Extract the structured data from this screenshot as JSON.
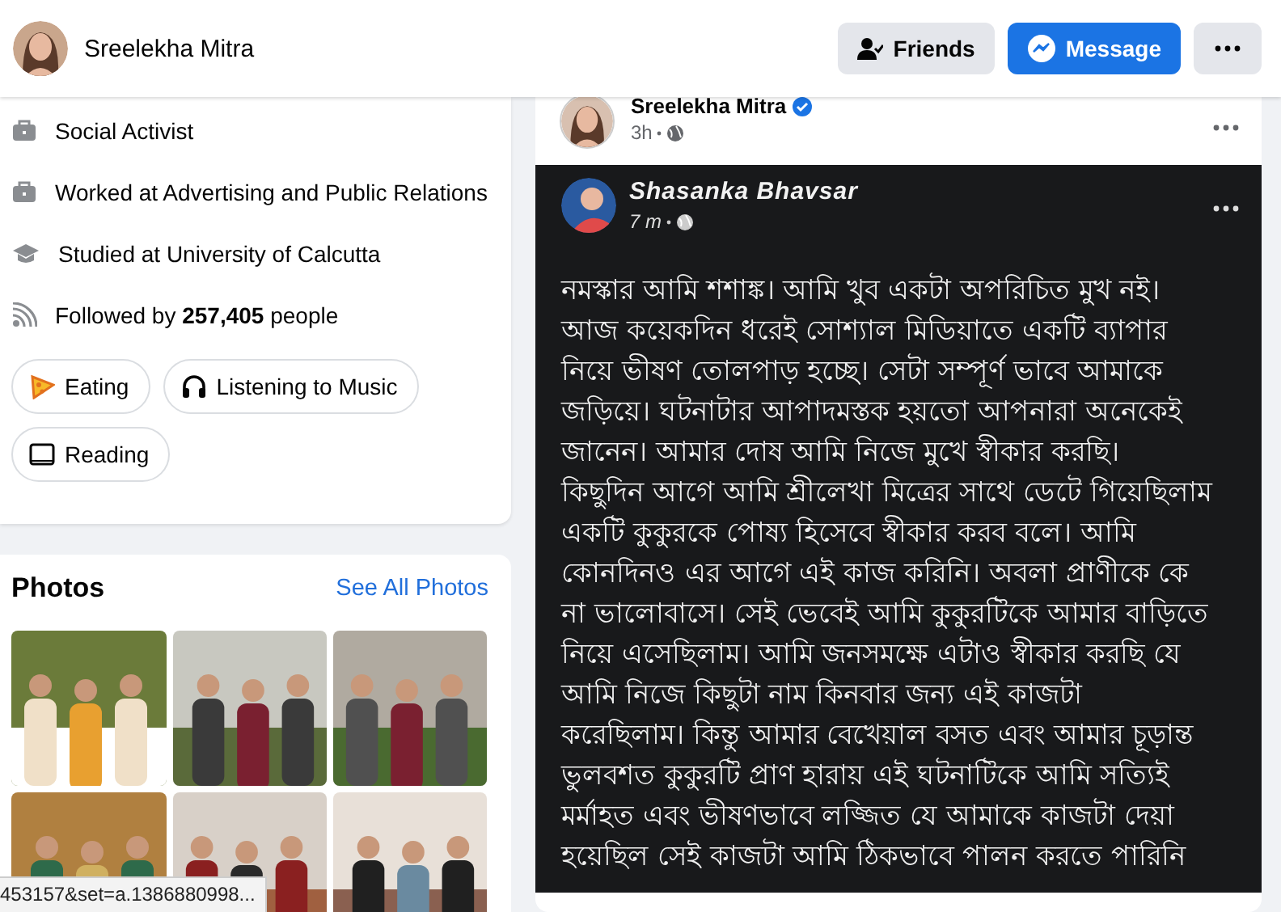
{
  "header": {
    "name": "Sreelekha Mitra",
    "buttons": [
      {
        "kind": "friends",
        "label": "Friends"
      },
      {
        "kind": "message",
        "label": "Message"
      },
      {
        "kind": "more"
      }
    ]
  },
  "intro": {
    "items": [
      {
        "kind": "work",
        "text": "Social Activist"
      },
      {
        "kind": "work",
        "text": "Worked at Advertising and Public Relations"
      },
      {
        "kind": "education",
        "text": "Studied at University of Calcutta"
      },
      {
        "kind": "followers",
        "text": "Followed by **257,405** people"
      }
    ],
    "hobbies": [
      {
        "kind": "food",
        "label": "Eating"
      },
      {
        "kind": "music",
        "label": "Listening to Music"
      },
      {
        "kind": "book",
        "label": "Reading"
      }
    ]
  },
  "photos": {
    "title": "Photos",
    "link": "See All Photos"
  },
  "post": {
    "author": "Sreelekha Mitra",
    "verified": true,
    "time": "3h",
    "shared": {
      "author": "Shasanka Bhavsar",
      "time": "7 m",
      "lines": [
        "নমস্কার আমি শশাঙ্ক। আমি খুব একটা  অপরিচিত মুখ নই।",
        "আজ কয়েকদিন ধরেই সোশ্যাল মিডিয়াতে একটি ব্যাপার",
        "নিয়ে ভীষণ তোলপাড় হচ্ছে। সেটা সম্পূর্ণ ভাবে আমাকে",
        "জড়িয়ে। ঘটনাটার আপাদমস্তক হয়তো আপনারা অনেকেই",
        "জানেন। আমার দোষ আমি নিজে মুখে স্বীকার করছি।",
        "কিছুদিন আগে আমি শ্রীলেখা মিত্রের সাথে ডেটে গিয়েছিলাম",
        "একটি কুকুরকে পোষ্য হিসেবে স্বীকার করব বলে। আমি",
        "কোনদিনও এর আগে এই কাজ করিনি। অবলা প্রাণীকে কে",
        "না ভালোবাসে। সেই ভেবেই আমি কুকুরটিকে আমার বাড়িতে",
        "নিয়ে এসেছিলাম। আমি জনসমক্ষে এটাও স্বীকার করছি যে",
        "আমি নিজে কিছুটা নাম কিনবার জন্য এই কাজটা",
        "করেছিলাম। কিন্তু আমার বেখেয়াল বসত এবং আমার চূড়ান্ত",
        "ভুলবশত কুকুরটি প্রাণ হারায় এই ঘটনাটিকে আমি সত্যিই",
        "মর্মাহত এবং ভীষণভাবে লজ্জিত যে আমাকে কাজটা দেয়া",
        "হয়েছিল সেই কাজটা আমি ঠিকভাবে পালন করতে পারিনি"
      ]
    }
  },
  "status_url": "453157&set=a.1386880998..."
}
